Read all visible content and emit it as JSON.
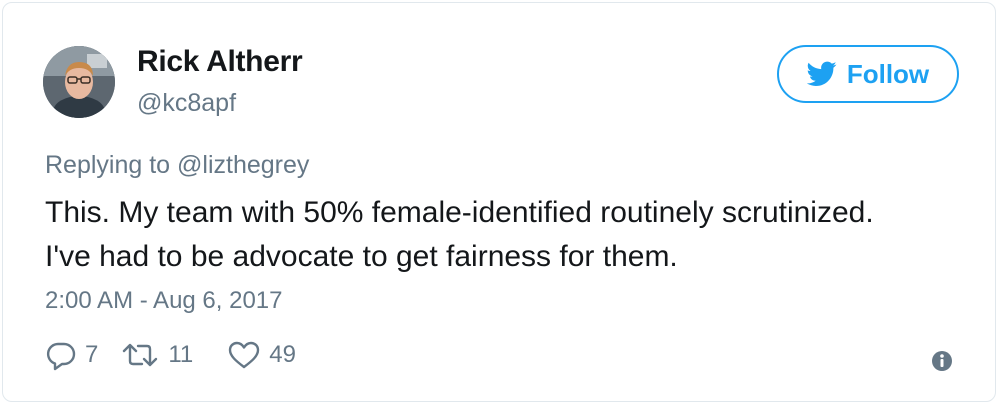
{
  "author": {
    "name": "Rick Altherr",
    "handle": "@kc8apf"
  },
  "follow": {
    "label": "Follow",
    "icon": "twitter-bird-icon"
  },
  "reply": {
    "prefix": "Replying to ",
    "mention": "@lizthegrey"
  },
  "tweet": {
    "lines": [
      "This. My team with 50% female-identified routinely scrutinized.",
      "I've had to be advocate to get fairness for them."
    ],
    "timestamp": "2:00 AM - Aug 6, 2017"
  },
  "actions": {
    "replies": "7",
    "retweets": "11",
    "likes": "49"
  },
  "colors": {
    "accent": "#1da1f2",
    "secondary_text": "#657786",
    "primary_text": "#14171a",
    "border": "#e1e8ed"
  }
}
